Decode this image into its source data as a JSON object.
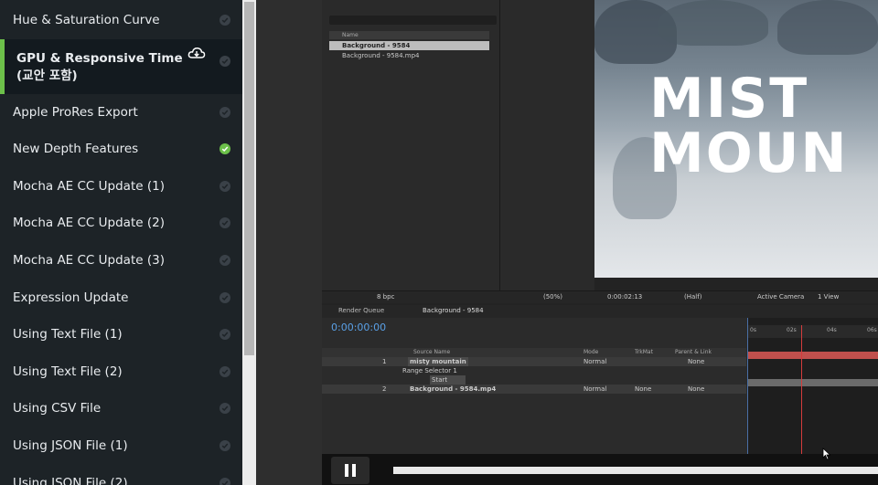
{
  "lessons": [
    {
      "label": "Hue & Saturation Curve",
      "done": false,
      "active": false
    },
    {
      "label": "GPU & Responsive Time (교안 포함)",
      "done": false,
      "active": true
    },
    {
      "label": "Apple ProRes Export",
      "done": false,
      "active": false
    },
    {
      "label": "New Depth Features",
      "done": true,
      "active": false
    },
    {
      "label": "Mocha AE CC Update (1)",
      "done": false,
      "active": false
    },
    {
      "label": "Mocha AE CC Update (2)",
      "done": false,
      "active": false
    },
    {
      "label": "Mocha AE CC Update (3)",
      "done": false,
      "active": false
    },
    {
      "label": "Expression Update",
      "done": false,
      "active": false
    },
    {
      "label": "Using Text File (1)",
      "done": false,
      "active": false
    },
    {
      "label": "Using Text File (2)",
      "done": false,
      "active": false
    },
    {
      "label": "Using CSV File",
      "done": false,
      "active": false
    },
    {
      "label": "Using JSON File (1)",
      "done": false,
      "active": false
    },
    {
      "label": "Using JSON File (2)",
      "done": false,
      "active": false
    }
  ],
  "colors": {
    "done": "#6cc04a",
    "accent": "#6cc04a",
    "sidebar_bg": "#1d2327"
  },
  "icons": {
    "download": "cloud-download-icon",
    "check": "check-circle-icon",
    "pause": "pause-icon"
  },
  "project": {
    "name_header": "Name",
    "items": [
      "Background - 9584",
      "Background - 9584.mp4"
    ]
  },
  "composition": {
    "title_line1": "MIST",
    "title_line2": "MOUN"
  },
  "comp_toolbar": {
    "zoom": "(50%)",
    "time": "0:00:02:13",
    "resolution": "(Half)",
    "camera": "Active Camera",
    "view": "1 View",
    "fps": "8 bpc"
  },
  "timeline": {
    "tabs": [
      "Render Queue",
      "Background - 9584"
    ],
    "timecode": "0:00:00:00",
    "columns": {
      "source": "Source Name",
      "mode": "Mode",
      "trkmat": "TrkMat",
      "parent": "Parent & Link"
    },
    "layers": [
      {
        "num": "1",
        "name": "misty mountain",
        "mode": "Normal",
        "parent": "None"
      },
      {
        "num": "",
        "name": "Range Selector 1",
        "mode": "",
        "parent": ""
      },
      {
        "num": "",
        "name": "Start",
        "mode": "",
        "parent": ""
      },
      {
        "num": "2",
        "name": "Background - 9584.mp4",
        "mode": "Normal",
        "trkmat": "None",
        "parent": "None"
      }
    ],
    "ruler": [
      "0s",
      "02s",
      "04s",
      "06s"
    ]
  },
  "player": {
    "progress": 0.0
  }
}
